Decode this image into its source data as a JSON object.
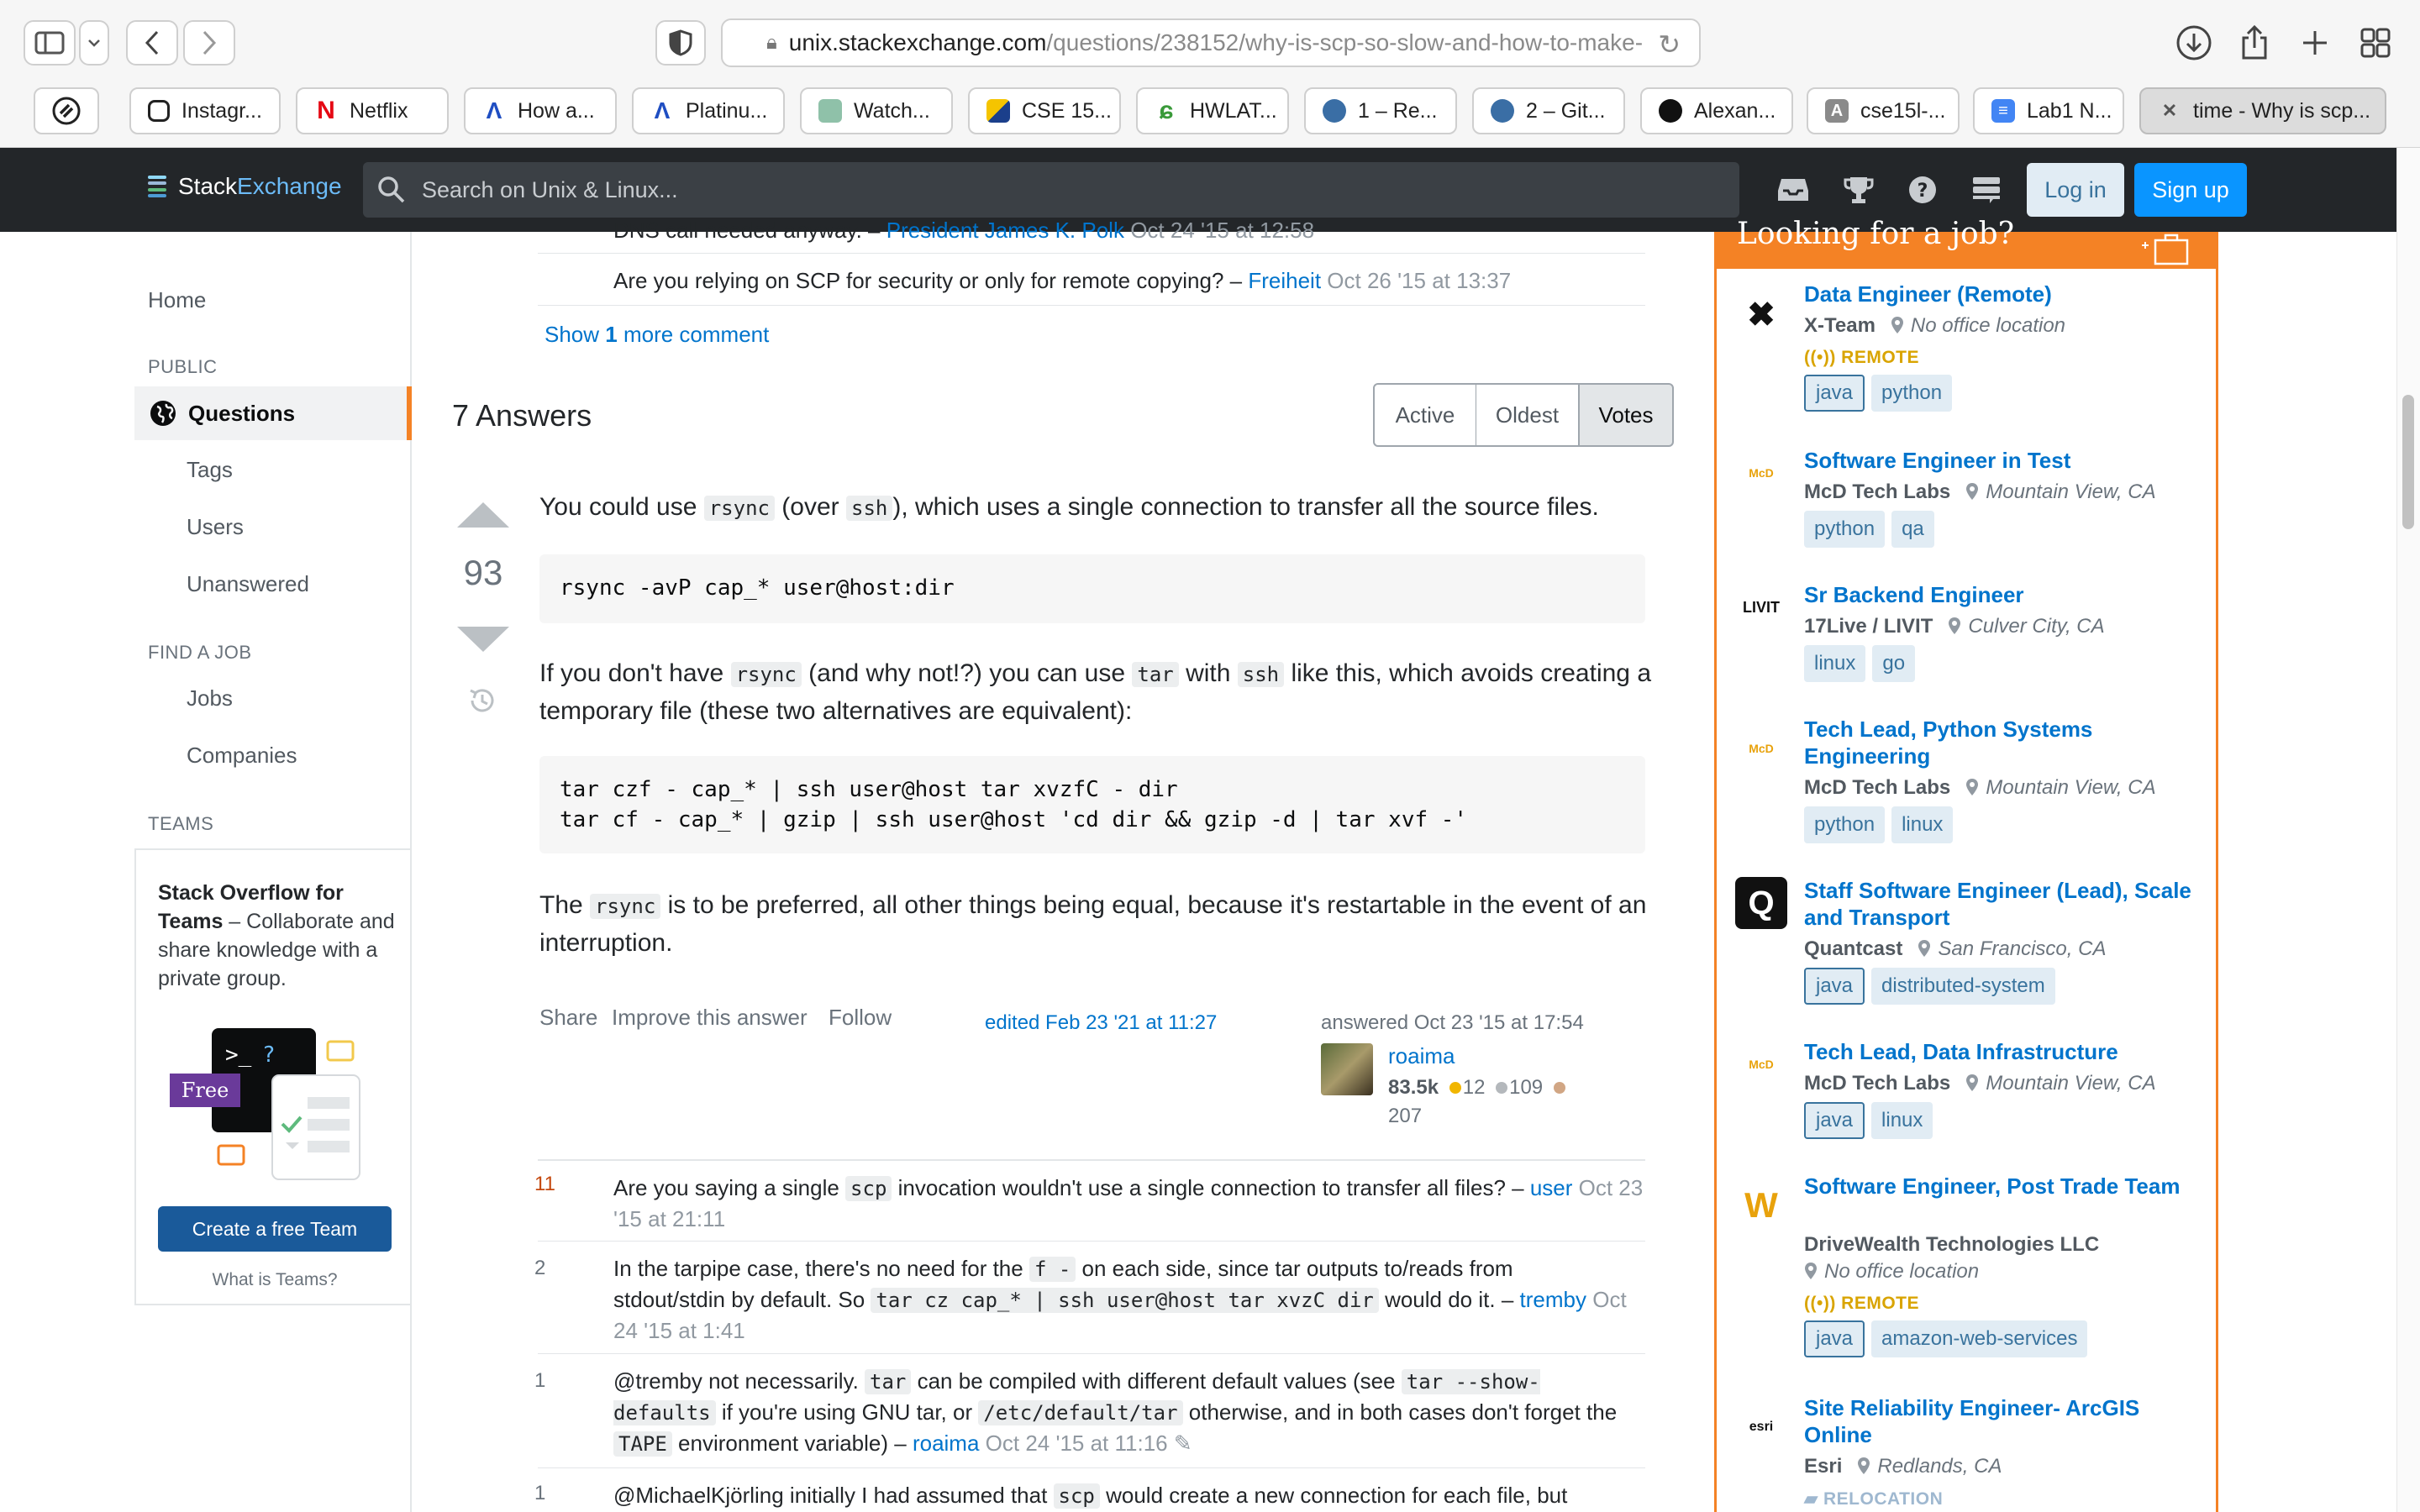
{
  "browser": {
    "url_domain": "unix.stackexchange.com",
    "url_path": "/questions/238152/why-is-scp-so-slow-and-how-to-make-",
    "favorites": [
      {
        "label": "",
        "icon": "chain-icon"
      },
      {
        "label": "Instagr...",
        "icon": "instagram-icon"
      },
      {
        "label": "Netflix",
        "icon": "netflix-icon"
      },
      {
        "label": "How a...",
        "icon": "a-logo-icon"
      },
      {
        "label": "Platinu...",
        "icon": "a-logo-icon"
      },
      {
        "label": "Watch...",
        "icon": "map-icon"
      },
      {
        "label": "CSE 15...",
        "icon": "cse-icon"
      },
      {
        "label": "HWLAT...",
        "icon": "leaf-icon"
      },
      {
        "label": "1 – Re...",
        "icon": "globe-icon"
      },
      {
        "label": "2 – Git...",
        "icon": "globe-icon"
      },
      {
        "label": "Alexan...",
        "icon": "github-icon"
      },
      {
        "label": "cse15l-...",
        "icon": "a-letter-icon"
      },
      {
        "label": "Lab1 N...",
        "icon": "docs-icon"
      },
      {
        "label": "time - Why is scp...",
        "icon": "close-icon"
      }
    ]
  },
  "se_bar": {
    "logo_stack": "Stack",
    "logo_exchange": "Exchange",
    "search_placeholder": "Search on Unix & Linux...",
    "login": "Log in",
    "signup": "Sign up"
  },
  "nav": {
    "home": "Home",
    "public": "PUBLIC",
    "questions": "Questions",
    "tags": "Tags",
    "users": "Users",
    "unanswered": "Unanswered",
    "find_job": "FIND A JOB",
    "jobs": "Jobs",
    "companies": "Companies",
    "teams": "TEAMS",
    "teams_title": "Stack Overflow for Teams",
    "teams_desc": " – Collaborate and share knowledge with a private group.",
    "teams_free": "Free",
    "create_team": "Create a free Team",
    "what_teams": "What is Teams?"
  },
  "question_comments": {
    "partial_text": "DNS call needed anyway. –",
    "partial_user": "President James K. Polk",
    "partial_date": "Oct 24 '15 at 12:58",
    "c1_text": "Are you relying on SCP for security or only for remote copying? –",
    "c1_user": "Freiheit",
    "c1_date": "Oct 26 '15 at 13:37",
    "show_pre": "Show ",
    "show_count": "1",
    "show_post": " more comment"
  },
  "answers": {
    "heading": "7 Answers",
    "sort": [
      "Active",
      "Oldest",
      "Votes"
    ],
    "vote_count": "93",
    "p1": [
      "You could use ",
      "rsync",
      " (over ",
      "ssh",
      "), which uses a single connection to transfer all the source files."
    ],
    "code1": "rsync -avP cap_* user@host:dir",
    "p2": [
      "If you don't have ",
      "rsync",
      " (and why not!?) you can use ",
      "tar",
      " with ",
      "ssh",
      " like this, which avoids creating a temporary file (these two alternatives are equivalent):"
    ],
    "code2": "tar czf - cap_* | ssh user@host tar xvzfC - dir\ntar cf - cap_* | gzip | ssh user@host 'cd dir && gzip -d | tar xvf -'",
    "p3": [
      "The ",
      "rsync",
      " is to be preferred, all other things being equal, because it's restartable in the event of an interruption."
    ],
    "share": "Share",
    "improve": "Improve this answer",
    "follow": "Follow",
    "edited": "edited Feb 23 '21 at 11:27",
    "answered": "answered Oct 23 '15 at 17:54",
    "user": "roaima",
    "rep": "83.5k",
    "gold": "12",
    "silver": "109",
    "bronze": "207"
  },
  "answer_comments": [
    {
      "score": "11",
      "hot": true,
      "parts": [
        "Are you saying a single ",
        "scp",
        " invocation wouldn't use a single connection to transfer all files? –"
      ],
      "user": "user",
      "date": "Oct 23 '15 at 21:11"
    },
    {
      "score": "2",
      "hot": false,
      "parts": [
        "In the tarpipe case, there's no need for the ",
        "f -",
        " on each side, since tar outputs to/reads from stdout/stdin by default. So ",
        "tar cz cap_* | ssh user@host tar xvzC dir",
        " would do it."
      ],
      "user": "tremby",
      "date": "Oct 24 '15 at 1:41"
    },
    {
      "score": "1",
      "hot": false,
      "parts": [
        "@tremby not necessarily. ",
        "tar",
        " can be compiled with different default values (see ",
        "tar --show-defaults",
        " if you're using GNU tar, or ",
        "/etc/default/tar",
        " otherwise, and in both cases don't forget the ",
        "TAPE",
        " environment variable) –"
      ],
      "user": "roaima",
      "date": "Oct 24 '15 at 11:16"
    },
    {
      "score": "1",
      "hot": false,
      "parts": [
        "@MichaelKjörling initially I had assumed that ",
        "scp",
        " would create a new connection for each file, but"
      ]
    }
  ],
  "jobs": {
    "header": "Looking for a job?",
    "items": [
      {
        "title": "Data Engineer (Remote)",
        "company": "X-Team",
        "location": "No office location",
        "badge": "REMOTE",
        "tags": [
          "java",
          "python"
        ],
        "logo": "x-team-logo-icon"
      },
      {
        "title": "Software Engineer in Test",
        "company": "McD Tech Labs",
        "location": "Mountain View, CA",
        "tags": [
          "python",
          "qa"
        ],
        "logo": "mcd-tech-labs-logo-icon"
      },
      {
        "title": "Sr Backend Engineer",
        "company": "17Live / LIVIT",
        "location": "Culver City, CA",
        "tags": [
          "linux",
          "go"
        ],
        "logo": "livit-logo-icon"
      },
      {
        "title": "Tech Lead, Python Systems Engineering",
        "company": "McD Tech Labs",
        "location": "Mountain View, CA",
        "tags": [
          "python",
          "linux"
        ],
        "logo": "mcd-tech-labs-logo-icon"
      },
      {
        "title": "Staff Software Engineer (Lead), Scale and Transport",
        "company": "Quantcast",
        "location": "San Francisco, CA",
        "tags": [
          "java",
          "distributed-system"
        ],
        "logo": "quantcast-logo-icon"
      },
      {
        "title": "Tech Lead, Data Infrastructure",
        "company": "McD Tech Labs",
        "location": "Mountain View, CA",
        "tags": [
          "java",
          "linux"
        ],
        "logo": "mcd-tech-labs-logo-icon"
      },
      {
        "title": "Software Engineer, Post Trade Team",
        "company": "DriveWealth Technologies LLC",
        "location": "No office location",
        "badge": "REMOTE",
        "tags": [
          "java",
          "amazon-web-services"
        ],
        "logo": "drivewealth-logo-icon"
      },
      {
        "title": "Site Reliability Engineer- ArcGIS Online",
        "company": "Esri",
        "location": "Redlands, CA",
        "badge": "RELOCATION",
        "logo": "esri-logo-icon"
      }
    ]
  },
  "colors": {
    "accent": "#f48225",
    "link": "#0074cc",
    "topbar": "#232629",
    "primary_button": "#0a95ff"
  }
}
